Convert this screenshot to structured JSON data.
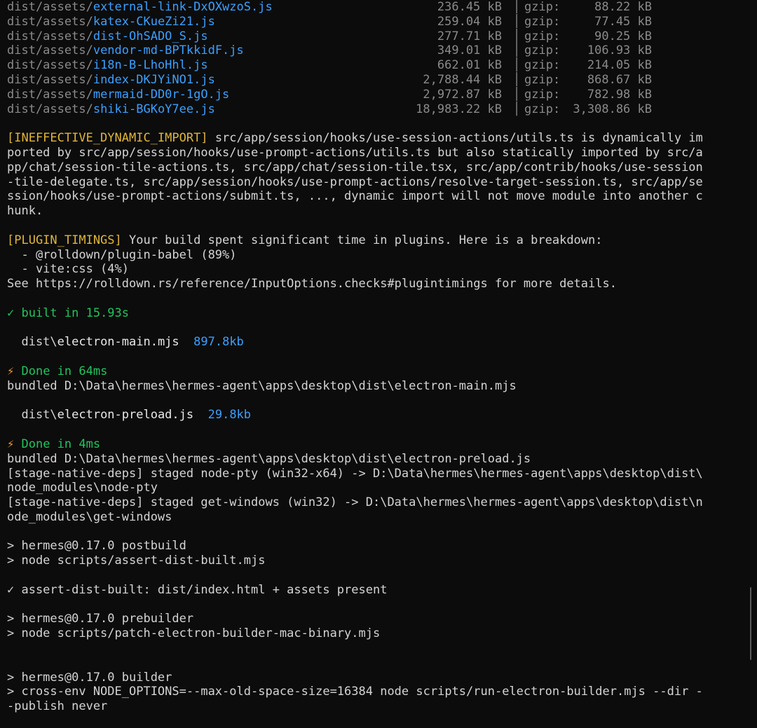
{
  "assets": [
    {
      "prefix": "dist/assets/",
      "name": "external-link-DxOXwzoS.js",
      "size": "236.45 kB",
      "gzip_label": "gzip:",
      "gzip": "88.22 kB"
    },
    {
      "prefix": "dist/assets/",
      "name": "katex-CKueZi21.js",
      "size": "259.04 kB",
      "gzip_label": "gzip:",
      "gzip": "77.45 kB"
    },
    {
      "prefix": "dist/assets/",
      "name": "dist-OhSADO_S.js",
      "size": "277.71 kB",
      "gzip_label": "gzip:",
      "gzip": "90.25 kB"
    },
    {
      "prefix": "dist/assets/",
      "name": "vendor-md-BPTkkidF.js",
      "size": "349.01 kB",
      "gzip_label": "gzip:",
      "gzip": "106.93 kB"
    },
    {
      "prefix": "dist/assets/",
      "name": "i18n-B-LhoHhl.js",
      "size": "662.01 kB",
      "gzip_label": "gzip:",
      "gzip": "214.05 kB"
    },
    {
      "prefix": "dist/assets/",
      "name": "index-DKJYiNO1.js",
      "size": "2,788.44 kB",
      "gzip_label": "gzip:",
      "gzip": "868.67 kB"
    },
    {
      "prefix": "dist/assets/",
      "name": "mermaid-DD0r-1gO.js",
      "size": "2,972.87 kB",
      "gzip_label": "gzip:",
      "gzip": "782.98 kB"
    },
    {
      "prefix": "dist/assets/",
      "name": "shiki-BGKoY7ee.js",
      "size": "18,983.22 kB",
      "gzip_label": "gzip:",
      "gzip": "3,308.86 kB"
    }
  ],
  "ineffective": {
    "tag": "[INEFFECTIVE_DYNAMIC_IMPORT]",
    "line1": " src/app/session/hooks/use-session-actions/utils.ts is dynamically im",
    "line2": "ported by src/app/session/hooks/use-prompt-actions/utils.ts but also statically imported by src/a",
    "line3": "pp/chat/session-tile-actions.ts, src/app/chat/session-tile.tsx, src/app/contrib/hooks/use-session",
    "line4": "-tile-delegate.ts, src/app/session/hooks/use-prompt-actions/resolve-target-session.ts, src/app/se",
    "line5": "ssion/hooks/use-prompt-actions/submit.ts, ..., dynamic import will not move module into another c",
    "line6": "hunk."
  },
  "plugin_timings": {
    "tag": "[PLUGIN_TIMINGS]",
    "text": " Your build spent significant time in plugins. Here is a breakdown:",
    "item1": "  - @rolldown/plugin-babel (89%)",
    "item2": "  - vite:css (4%)",
    "see": "See https://rolldown.rs/reference/InputOptions.checks#plugintimings for more details."
  },
  "built": {
    "check": "✓",
    "text": " built in 15.93s"
  },
  "electron_main": {
    "indent": "  dist\\",
    "file": "electron-main.mjs",
    "size": "897.8kb",
    "bolt": "⚡",
    "done": " Done in 64ms",
    "bundled": "bundled D:\\Data\\hermes\\hermes-agent\\apps\\desktop\\dist\\electron-main.mjs"
  },
  "electron_preload": {
    "indent": "  dist\\",
    "file": "electron-preload.js",
    "size": "29.8kb",
    "bolt": "⚡",
    "done": " Done in 4ms",
    "bundled": "bundled D:\\Data\\hermes\\hermes-agent\\apps\\desktop\\dist\\electron-preload.js"
  },
  "native_deps": {
    "line1": "[stage-native-deps] staged node-pty (win32-x64) -> D:\\Data\\hermes\\hermes-agent\\apps\\desktop\\dist\\",
    "line2": "node_modules\\node-pty",
    "line3": "[stage-native-deps] staged get-windows (win32) -> D:\\Data\\hermes\\hermes-agent\\apps\\desktop\\dist\\n",
    "line4": "ode_modules\\get-windows"
  },
  "postbuild": {
    "line1": "> hermes@0.17.0 postbuild",
    "line2": "> node scripts/assert-dist-built.mjs",
    "check": "✓ assert-dist-built: dist/index.html + assets present"
  },
  "prebuilder": {
    "line1": "> hermes@0.17.0 prebuilder",
    "line2": "> node scripts/patch-electron-builder-mac-binary.mjs"
  },
  "builder": {
    "line1": "> hermes@0.17.0 builder",
    "line2": "> cross-env NODE_OPTIONS=--max-old-space-size=16384 node scripts/run-electron-builder.mjs --dir -",
    "line3": "-publish never"
  },
  "colors": {
    "background": "#0c0c0c",
    "asset_blue": "#3aa0ff",
    "warn_yellow": "#e0b53a",
    "success_green": "#21c55d",
    "bolt_orange": "#f59a2f"
  }
}
